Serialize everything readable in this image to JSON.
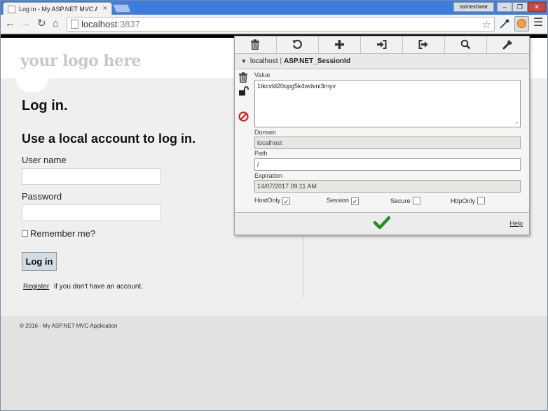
{
  "browser": {
    "tab_title": "Log in - My ASP.NET MVC A",
    "tab_close": "×",
    "user_name": "saineshwar",
    "window_min": "–",
    "window_max": "❐",
    "window_close": "✕",
    "url_host": "localhost",
    "url_port": ":3837",
    "icons": {
      "back": "arrow-left-icon",
      "forward": "arrow-right-icon",
      "reload": "reload-icon",
      "home": "home-icon",
      "star": "star-icon",
      "eyedropper": "eyedropper-icon",
      "extension": "cookie-icon",
      "menu": "menu-icon"
    }
  },
  "page": {
    "logo": "your logo here",
    "title": "Log in.",
    "section_title": "Use a local account to log in.",
    "username_label": "User name",
    "username_value": "",
    "password_label": "Password",
    "password_value": "",
    "remember_label": "Remember me?",
    "remember_checked": false,
    "login_button": "Log in",
    "register_link": "Register",
    "register_text": "if you don't have an account.",
    "copyright": "© 2016 - My ASP.NET MVC Application"
  },
  "cookie_editor": {
    "toolbar_icons": [
      "trash-icon",
      "undo-icon",
      "plus-icon",
      "import-icon",
      "export-icon",
      "search-icon",
      "wrench-icon"
    ],
    "domain_host": "localhost",
    "separator": "|",
    "cookie_name": "ASP.NET_SessionId",
    "value_label": "Value",
    "value": "1tkcvld20opg5k4wdvni3myv",
    "domain_label": "Domain",
    "domain": "localhost",
    "path_label": "Path",
    "path": "/",
    "expiration_label": "Expiration",
    "expiration": "14/07/2017 09:11 AM",
    "flags": {
      "hostonly_label": "HostOnly",
      "hostonly": true,
      "session_label": "Session",
      "session": true,
      "secure_label": "Secure",
      "secure": false,
      "httponly_label": "HttpOnly",
      "httponly": false
    },
    "help": "Help",
    "colors": {
      "delete_red": "#cc2222",
      "save_green": "#1e8f1e"
    }
  }
}
